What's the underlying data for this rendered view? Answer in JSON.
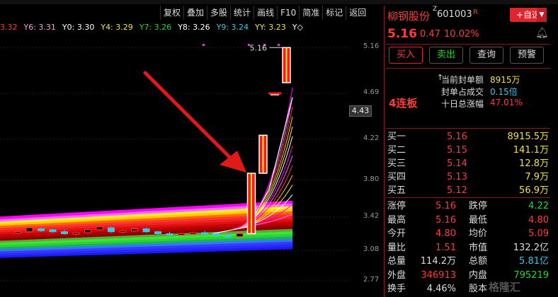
{
  "toolbar": [
    "复权",
    "叠加",
    "多股",
    "统计",
    "画线",
    "F10",
    "简准",
    "标记",
    "返回"
  ],
  "ma_line": [
    {
      "label": "3.32",
      "color": "#ff3b3b"
    },
    {
      "label": "Y6: 3.31",
      "color": "#ff9ce0"
    },
    {
      "label": "Y0: 3.30",
      "color": "#ffffff"
    },
    {
      "label": "Y4: 3.29",
      "color": "#f1e04a"
    },
    {
      "label": "Y7: 3.26",
      "color": "#2ad42a"
    },
    {
      "label": "Y8: 3.26",
      "color": "#ffffff"
    },
    {
      "label": "Y9: 3.24",
      "color": "#38c8e8"
    },
    {
      "label": "YY: 3.23",
      "color": "#f1e04a"
    },
    {
      "label": "Y◇",
      "color": "#ffffff"
    }
  ],
  "chart_data": {
    "type": "candlestick",
    "y_ticks": [
      "5.16",
      "4.69",
      "4.22",
      "3.80",
      "3.42",
      "3.08",
      "2.77"
    ],
    "current_price_box": "4.43",
    "annotation_high": "5.16",
    "annotation_limit": "4连板",
    "ohlc": [
      [
        3.27,
        3.29,
        3.25,
        3.27
      ],
      [
        3.27,
        3.33,
        3.26,
        3.31
      ],
      [
        3.3,
        3.31,
        3.27,
        3.28
      ],
      [
        3.29,
        3.3,
        3.26,
        3.27
      ],
      [
        3.27,
        3.29,
        3.24,
        3.25
      ],
      [
        3.25,
        3.27,
        3.23,
        3.26
      ],
      [
        3.26,
        3.3,
        3.25,
        3.29
      ],
      [
        3.29,
        3.33,
        3.28,
        3.32
      ],
      [
        3.31,
        3.32,
        3.26,
        3.27
      ],
      [
        3.27,
        3.29,
        3.25,
        3.28
      ],
      [
        3.28,
        3.31,
        3.27,
        3.3
      ],
      [
        3.3,
        3.31,
        3.26,
        3.27
      ],
      [
        3.27,
        3.28,
        3.24,
        3.25
      ],
      [
        3.25,
        3.27,
        3.22,
        3.24
      ],
      [
        3.24,
        3.26,
        3.23,
        3.25
      ],
      [
        3.25,
        3.27,
        3.24,
        3.26
      ],
      [
        3.26,
        3.28,
        3.24,
        3.25
      ],
      [
        3.25,
        3.26,
        3.22,
        3.23
      ],
      [
        3.23,
        3.24,
        3.21,
        3.22
      ],
      [
        3.22,
        3.26,
        3.21,
        3.25
      ],
      [
        3.25,
        3.87,
        3.25,
        3.87
      ],
      [
        3.87,
        4.26,
        3.87,
        4.26
      ],
      [
        4.69,
        4.69,
        4.69,
        4.69
      ],
      [
        4.8,
        5.16,
        4.8,
        5.16
      ]
    ]
  },
  "stock": {
    "name": "柳钢股份",
    "code": "601003",
    "flag_z": "Z",
    "flag_r": "R",
    "price": "5.16",
    "change": "0.47",
    "change_pct": "10.02%",
    "add_fav": "+自选"
  },
  "buttons": [
    "买入",
    "卖出",
    "查询",
    "预警"
  ],
  "seal": {
    "board_label": "4连板",
    "rows": [
      {
        "label": "当前封单额",
        "value": "8915万",
        "color": "#f1e04a"
      },
      {
        "label": "封单占成交",
        "value": "0.15倍",
        "color": "#38c8e8"
      },
      {
        "label": "十日总涨幅",
        "value": "47.01%",
        "color": "#ff3b3b"
      }
    ]
  },
  "orderbook": [
    {
      "label": "买一",
      "price": "5.16",
      "vol": "8915.5万"
    },
    {
      "label": "买二",
      "price": "5.15",
      "vol": "141.1万"
    },
    {
      "label": "买三",
      "price": "5.14",
      "vol": "12.8万"
    },
    {
      "label": "买四",
      "price": "5.13",
      "vol": "7.9万"
    },
    {
      "label": "买五",
      "price": "5.12",
      "vol": "56.9万"
    }
  ],
  "stats": [
    {
      "l1": "涨停",
      "v1": "5.16",
      "c1": "#ff3b3b",
      "l2": "跌停",
      "v2": "4.22",
      "c2": "#2ad42a"
    },
    {
      "l1": "最高",
      "v1": "5.16",
      "c1": "#ff3b3b",
      "l2": "最低",
      "v2": "4.80",
      "c2": "#ff3b3b"
    },
    {
      "l1": "今开",
      "v1": "4.80",
      "c1": "#ff3b3b",
      "l2": "均价",
      "v2": "5.09",
      "c2": "#ff3b3b"
    },
    {
      "l1": "量比",
      "v1": "1.51",
      "c1": "#ff3b3b",
      "l2": "市值",
      "v2": "132.2亿",
      "c2": "#dddddd"
    },
    {
      "l1": "总量",
      "v1": "114.2万",
      "c1": "#dddddd",
      "l2": "总额",
      "v2": "5.81亿",
      "c2": "#38c8e8"
    },
    {
      "l1": "外盘",
      "v1": "346913",
      "c1": "#ff3b3b",
      "l2": "内盘",
      "v2": "795219",
      "c2": "#2ad42a"
    },
    {
      "l1": "换手",
      "v1": "4.46%",
      "c1": "#dddddd",
      "l2": "股本",
      "v2": "",
      "c2": "#dddddd"
    }
  ],
  "watermark": "格隆汇"
}
